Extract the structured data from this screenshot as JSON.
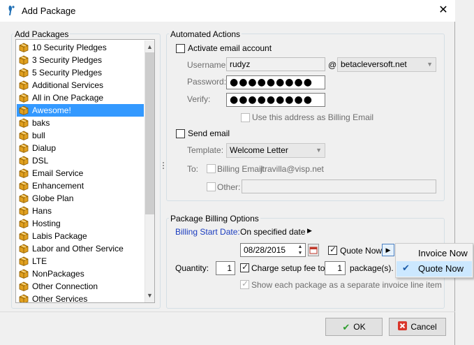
{
  "window": {
    "title": "Add Package",
    "close_label": "✕"
  },
  "packages": {
    "legend": "Add Packages",
    "items": [
      "10 Security Pledges",
      "3 Security Pledges",
      "5 Security Pledges",
      "Additional Services",
      "All in One Package",
      "Awesome!",
      "baks",
      "bull",
      "Dialup",
      "DSL",
      "Email Service",
      "Enhancement",
      "Globe Plan",
      "Hans",
      "Hosting",
      "Labis Package",
      "Labor and Other Service",
      "LTE",
      "NonPackages",
      "Other Connection",
      "Other Services"
    ],
    "selected": "Awesome!",
    "scroll_up": "▲",
    "scroll_down": "▼"
  },
  "automated": {
    "legend": "Automated Actions",
    "activate_email_label": "Activate email account",
    "activate_email_checked": false,
    "username_label": "Username:",
    "username_value": "rudyz",
    "at_sign": "@",
    "domain_value": "betacleversoft.net",
    "password_label": "Password:",
    "password_value": "●●●●●●●●●",
    "verify_label": "Verify:",
    "verify_value": "●●●●●●●●●",
    "billing_email_label": "Use this address as Billing Email",
    "send_email_label": "Send email",
    "send_email_checked": false,
    "template_label": "Template:",
    "template_value": "Welcome Letter",
    "to_label": "To:",
    "billing_email_to_label": "Billing Email:",
    "billing_email_to_value": "jtravilla@visp.net",
    "other_label": "Other:",
    "other_value": ""
  },
  "billing": {
    "legend": "Package Billing Options",
    "start_date_label": "Billing Start Date:",
    "start_mode": "On specified date",
    "mode_arrow": "▶",
    "date_value": "08/28/2015",
    "quote_now_label": "Quote Now",
    "quote_now_checked": true,
    "quantity_label": "Quantity:",
    "quantity_value": "1",
    "charge_setup_label": "Charge setup fee to",
    "charge_setup_checked": true,
    "setup_packages_value": "1",
    "packages_suffix": "package(s).",
    "separate_line_label": "Show each package as a separate invoice line item",
    "separate_line_checked": true
  },
  "popup_menu": {
    "items": [
      {
        "label": "Invoice Now",
        "checked": false
      },
      {
        "label": "Quote Now",
        "checked": true
      }
    ],
    "check_glyph": "✔"
  },
  "buttons": {
    "ok_label": "OK",
    "cancel_label": "Cancel"
  },
  "colors": {
    "selection": "#3399ff",
    "link_blue": "#1a3cbf",
    "ok_green": "#2e9e2e",
    "cancel_red": "#d9362b"
  }
}
